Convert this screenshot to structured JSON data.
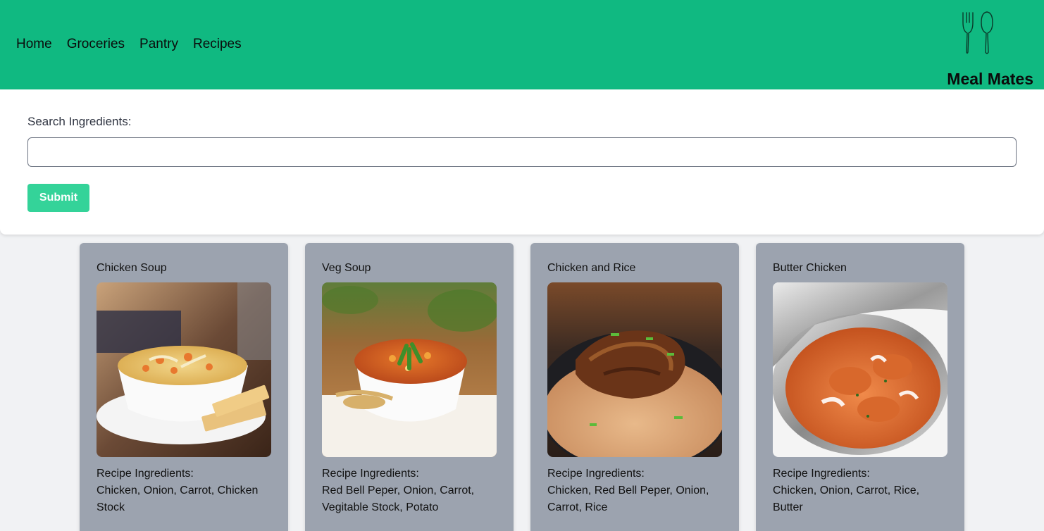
{
  "nav": {
    "links": [
      {
        "label": "Home"
      },
      {
        "label": "Groceries"
      },
      {
        "label": "Pantry"
      },
      {
        "label": "Recipes"
      }
    ],
    "brand": "Meal Mates",
    "logo_icon": "fork-spoon-icon"
  },
  "search": {
    "label": "Search Ingredients:",
    "value": "",
    "placeholder": "",
    "submit_label": "Submit"
  },
  "recipes": [
    {
      "title": "Chicken Soup",
      "ingredients_label": "Recipe Ingredients:",
      "ingredients": "Chicken, Onion, Carrot, Chicken Stock",
      "image": "chicken-soup-photo"
    },
    {
      "title": "Veg Soup",
      "ingredients_label": "Recipe Ingredients:",
      "ingredients": "Red Bell Peper, Onion, Carrot, Vegitable Stock, Potato",
      "image": "veg-soup-photo"
    },
    {
      "title": "Chicken and Rice",
      "ingredients_label": "Recipe Ingredients:",
      "ingredients": "Chicken, Red Bell Peper, Onion, Carrot, Rice",
      "image": "chicken-and-rice-photo"
    },
    {
      "title": "Butter Chicken",
      "ingredients_label": "Recipe Ingredients:",
      "ingredients": "Chicken, Onion, Carrot, Rice, Butter",
      "image": "butter-chicken-photo"
    }
  ],
  "colors": {
    "navbar": "#10b981",
    "submit": "#34d399",
    "card": "#9ca3af",
    "page_bg": "#f1f2f4"
  }
}
